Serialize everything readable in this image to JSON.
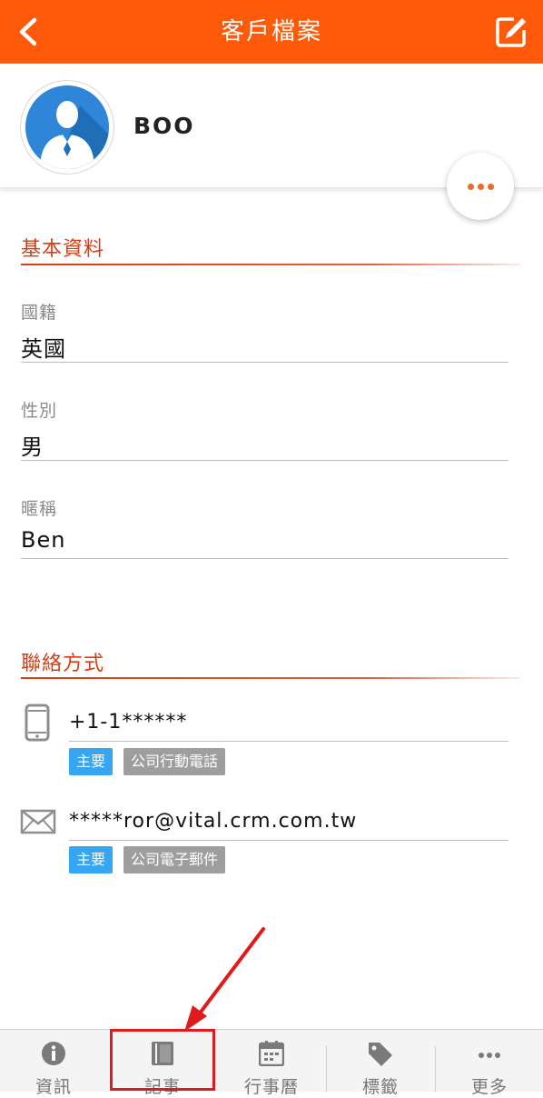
{
  "header": {
    "title": "客戶檔案",
    "back_icon": "chevron-left-icon",
    "edit_icon": "edit-icon"
  },
  "profile": {
    "name": "BOO",
    "avatar_icon": "person-avatar-icon",
    "more_icon": "more-horizontal-icon"
  },
  "basic_info": {
    "title": "基本資料",
    "fields": [
      {
        "label": "國籍",
        "value": "英國"
      },
      {
        "label": "性別",
        "value": "男"
      },
      {
        "label": "暱稱",
        "value": "Ben"
      }
    ]
  },
  "contact": {
    "title": "聯絡方式",
    "items": [
      {
        "icon": "mobile-phone-icon",
        "value": "+1-1******",
        "tags": [
          "主要",
          "公司行動電話"
        ]
      },
      {
        "icon": "envelope-icon",
        "value": "*****ror@vital.crm.com.tw",
        "tags": [
          "主要",
          "公司電子郵件"
        ]
      }
    ]
  },
  "bottom_nav": {
    "items": [
      {
        "label": "資訊",
        "icon": "info-icon"
      },
      {
        "label": "記事",
        "icon": "notebook-icon"
      },
      {
        "label": "行事曆",
        "icon": "calendar-icon"
      },
      {
        "label": "標籤",
        "icon": "tag-icon"
      },
      {
        "label": "更多",
        "icon": "more-horizontal-icon"
      }
    ]
  },
  "colors": {
    "header": "#ff5a0a",
    "accent": "#d83c12",
    "primary_tag": "#36a6f2",
    "secondary_tag": "#9e9e9e",
    "highlight": "#e11b1b"
  }
}
